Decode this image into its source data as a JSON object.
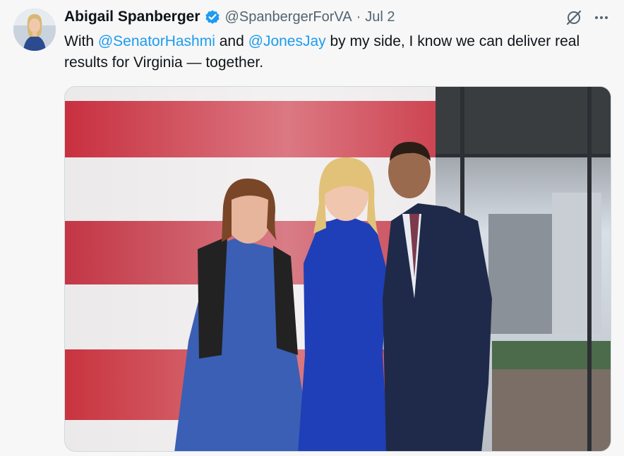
{
  "author": {
    "display_name": "Abigail Spanberger",
    "handle": "@SpanbergerForVA",
    "separator": "·",
    "date": "Jul 2",
    "verified": true
  },
  "tweet": {
    "text_parts": [
      "With ",
      "@SenatorHashmi",
      " and ",
      "@JonesJay",
      " by my side, I know we can deliver real results for Virginia — together."
    ]
  },
  "icons": {
    "verified": "verified-badge-icon",
    "grok": "grok-icon",
    "more": "more-options-icon"
  },
  "colors": {
    "link": "#1d9bf0",
    "verified": "#1d9bf0",
    "secondary_text": "#536471"
  }
}
